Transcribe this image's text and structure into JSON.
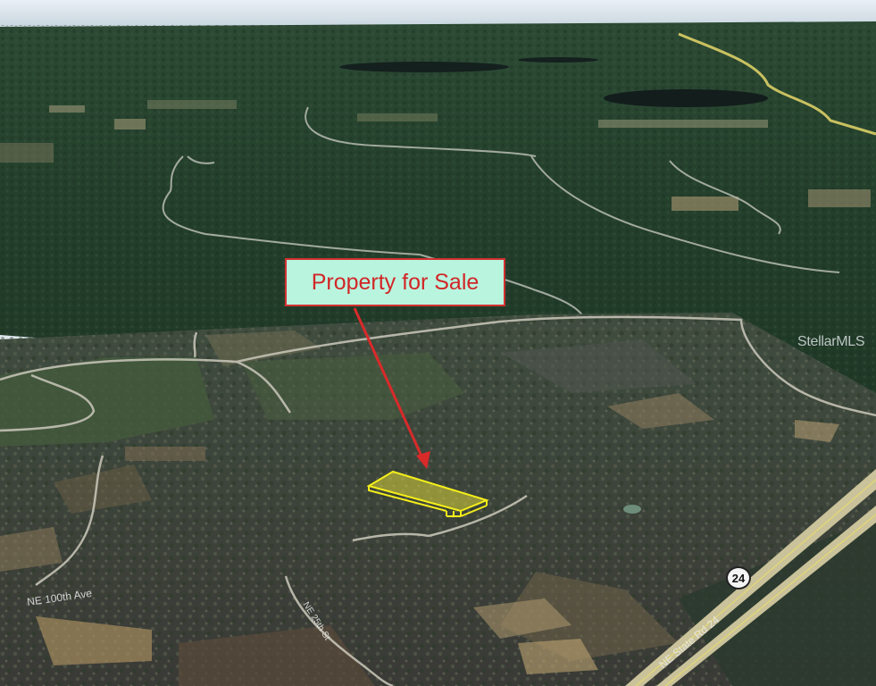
{
  "map": {
    "callout_text": "Property for Sale",
    "watermark": "StellarMLS",
    "route_shield": "24",
    "road_labels": {
      "ne_avenue": "NE 100th Ave",
      "state_road": "NE State Rd 24",
      "side_street": "NE 25th St"
    },
    "colors": {
      "parcel_outline": "#f4ee1a",
      "arrow": "#d92a2a",
      "callout_border": "#d33030",
      "callout_fill": "#b9f4df",
      "highway": "#d6c96a"
    }
  }
}
